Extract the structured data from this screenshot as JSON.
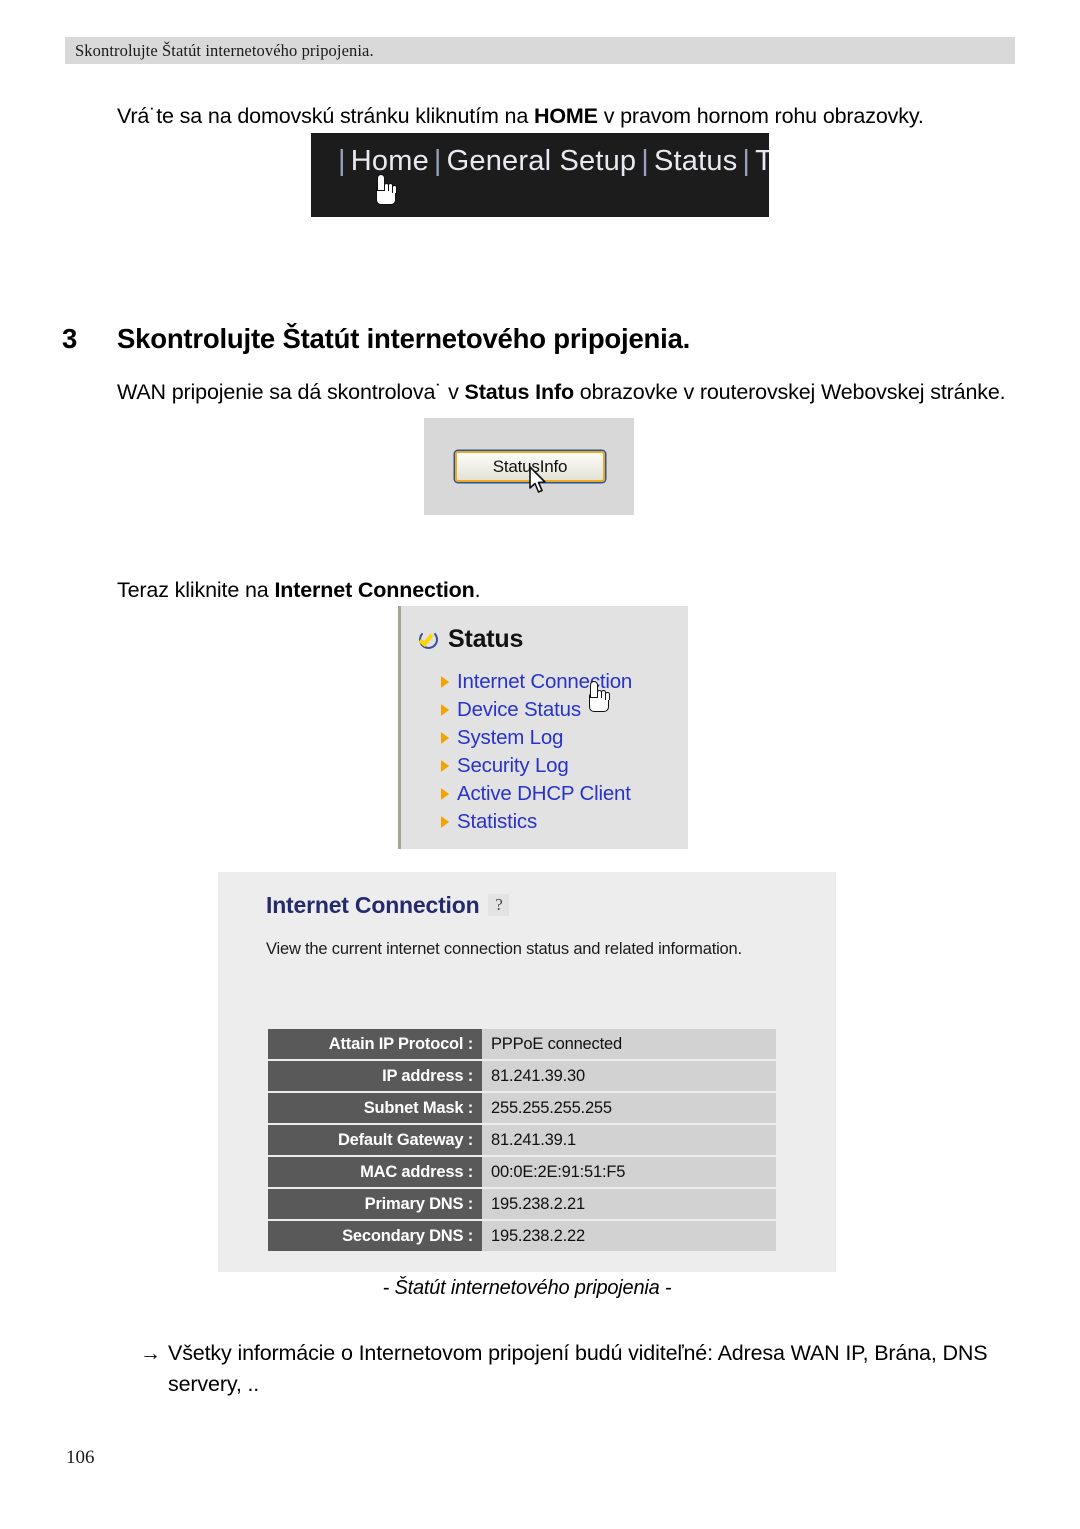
{
  "running_header": "Skontrolujte Štatút internetového pripojenia.",
  "intro_paragraph": {
    "before": "Vrá˙te sa na domovskú stránku kliknutím na ",
    "bold": "HOME",
    "after": " v pravom hornom rohu obrazovky."
  },
  "nav_screenshot": {
    "items": [
      "Home",
      "General Setup",
      "Status",
      "Tool"
    ],
    "separator": "|",
    "background_color": "#1c1c1c",
    "text_color": "#e9e9f2",
    "cursor": "hand-cursor"
  },
  "section": {
    "number": "3",
    "title": "Skontrolujte Štatút internetového pripojenia."
  },
  "wan_paragraph": {
    "before": "WAN pripojenie sa dá skontrolova˙ v  ",
    "bold": "Status Info",
    "after": " obrazovke v routerovskej Webovskej stránke."
  },
  "statusinfo_screenshot": {
    "button_label": "StatusInfo",
    "panel_background": "#d8d8d8",
    "button_border_color": "#f0a81e",
    "button_outline_color": "#2a5699",
    "cursor": "arrow-cursor"
  },
  "teraz_paragraph": {
    "before": "Teraz kliknite na ",
    "bold": "Internet Connection",
    "after": "."
  },
  "status_screenshot": {
    "title": "Status",
    "title_icon": "check-circle-icon",
    "links": [
      "Internet Connection",
      "Device Status",
      "System Log",
      "Security Log",
      "Active DHCP Client",
      "Statistics"
    ],
    "link_color": "#2933c9",
    "bullet_color": "#f0a400",
    "panel_background": "#e2e2e2",
    "cursor": "hand-cursor"
  },
  "internet_connection_screenshot": {
    "title": "Internet Connection",
    "help_icon": "help-question-icon",
    "help_icon_glyph": "?",
    "description": "View the current internet connection status and related information.",
    "title_color": "#242a6b",
    "label_cell_color": "#595959",
    "value_cell_color": "#d2d2d2",
    "rows": [
      {
        "label": "Attain IP Protocol :",
        "value": "PPPoE connected"
      },
      {
        "label": "IP address :",
        "value": "81.241.39.30"
      },
      {
        "label": "Subnet Mask :",
        "value": "255.255.255.255"
      },
      {
        "label": "Default Gateway :",
        "value": "81.241.39.1"
      },
      {
        "label": "MAC address :",
        "value": "00:0E:2E:91:51:F5"
      },
      {
        "label": "Primary DNS :",
        "value": "195.238.2.21"
      },
      {
        "label": "Secondary DNS :",
        "value": "195.238.2.22"
      }
    ]
  },
  "figure_caption": "- Štatút internetového pripojenia -",
  "final_paragraph": {
    "arrow": "→",
    "text": "Všetky informácie o Internetovom pripojení budú viditeľné: Adresa WAN IP, Brána, DNS servery, .."
  },
  "page_number": "106"
}
